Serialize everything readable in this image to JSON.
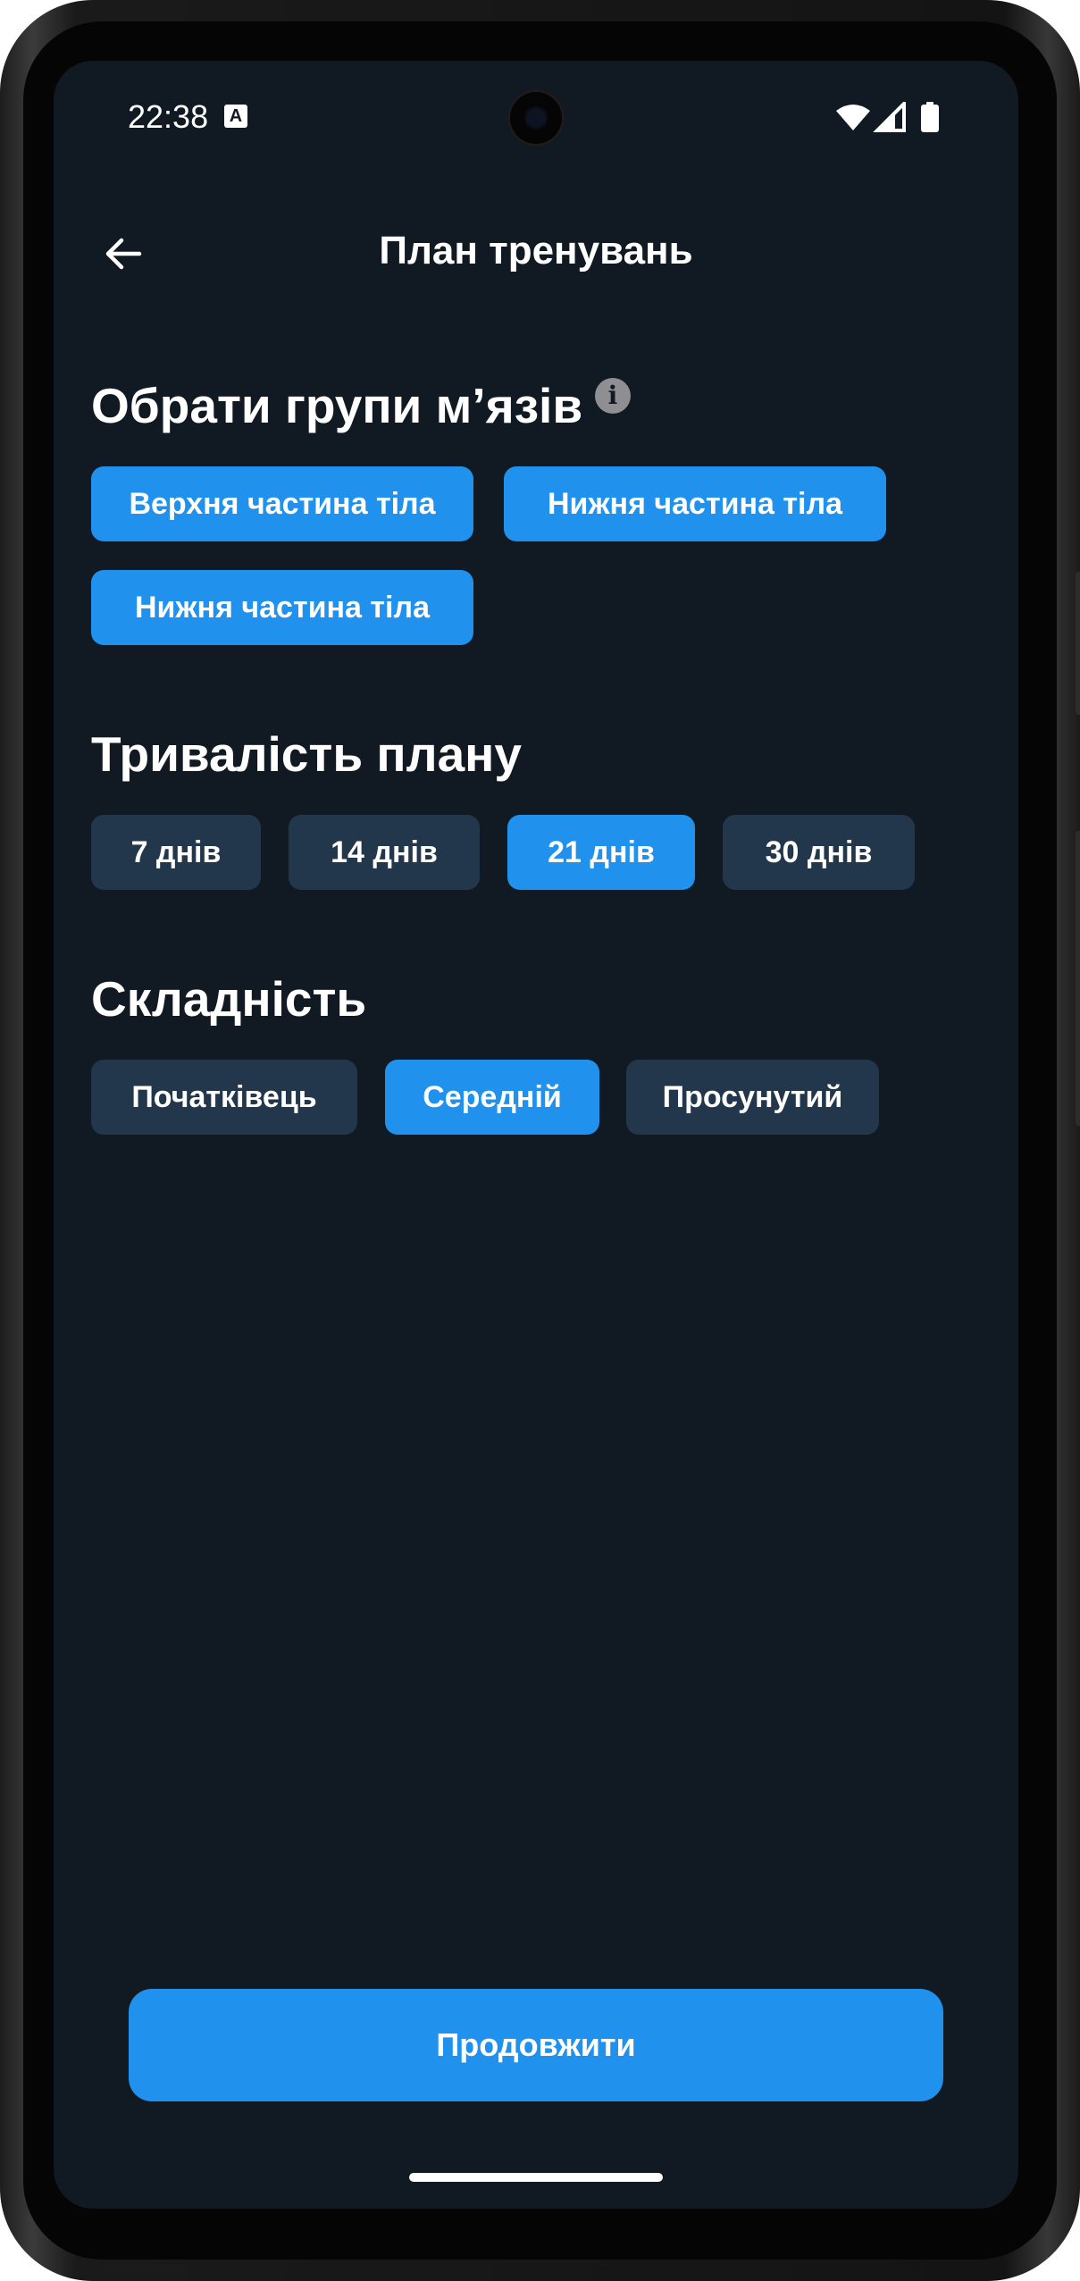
{
  "status_bar": {
    "time": "22:38",
    "notification_icon": "A",
    "icons": [
      "wifi-icon",
      "cellular-signal-icon",
      "battery-icon"
    ]
  },
  "header": {
    "title": "План тренувань",
    "back_icon": "arrow-left-icon"
  },
  "muscle_groups": {
    "title": "Обрати групи м’язів",
    "info_icon_glyph": "i",
    "options": [
      {
        "label": "Верхня частина тіла",
        "selected": true
      },
      {
        "label": "Нижня частина тіла",
        "selected": true
      },
      {
        "label": "Нижня частина тіла",
        "selected": true
      }
    ]
  },
  "duration": {
    "title": "Тривалість плану",
    "options": [
      {
        "label": "7 днів",
        "selected": false
      },
      {
        "label": "14 днів",
        "selected": false
      },
      {
        "label": "21 днів",
        "selected": true
      },
      {
        "label": "30 днів",
        "selected": false
      }
    ]
  },
  "difficulty": {
    "title": "Складність",
    "options": [
      {
        "label": "Початківець",
        "selected": false
      },
      {
        "label": "Середній",
        "selected": true
      },
      {
        "label": "Просунутий",
        "selected": false
      }
    ]
  },
  "footer": {
    "continue_label": "Продовжити"
  },
  "colors": {
    "background": "#111a22",
    "chip": "#22374c",
    "accent": "#2091ec",
    "text": "#ffffff"
  }
}
